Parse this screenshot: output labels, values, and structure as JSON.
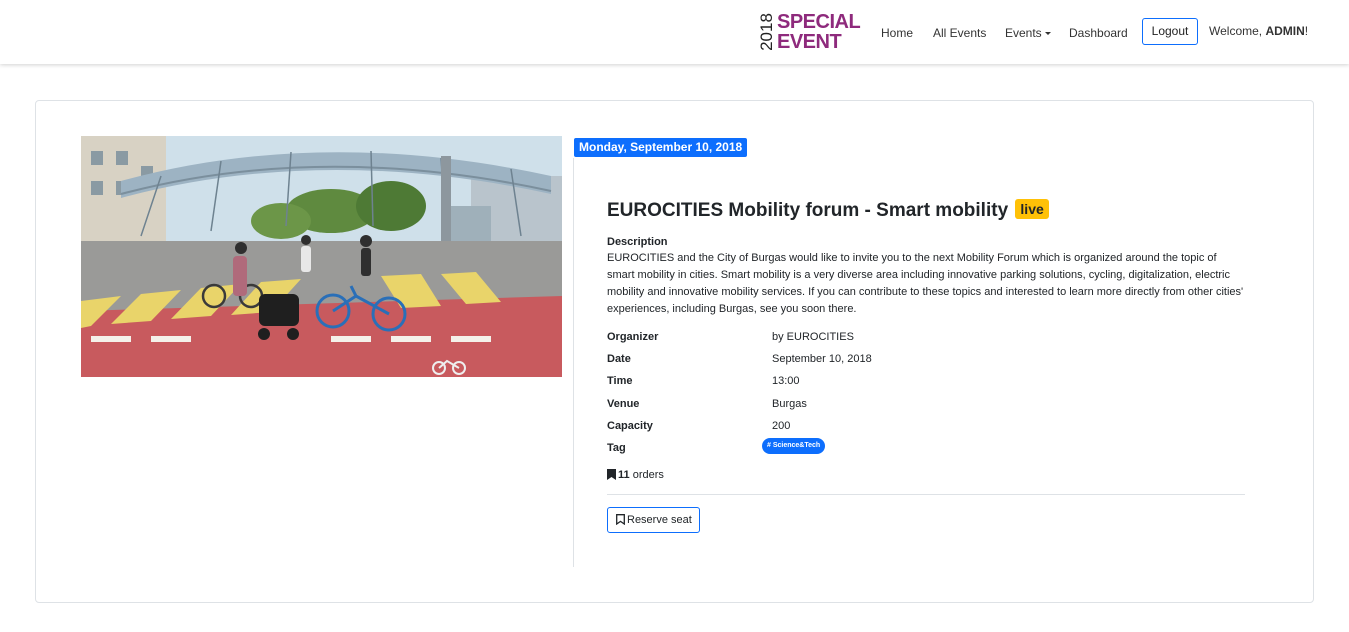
{
  "navbar": {
    "brand_year": "2018",
    "brand_line1": "SPECIAL",
    "brand_line2": "EVENT",
    "links": {
      "home": "Home",
      "all_events": "All Events",
      "events": "Events",
      "dashboard": "Dashboard"
    },
    "logout": "Logout",
    "welcome_prefix": "Welcome, ",
    "welcome_user": "ADMIN",
    "welcome_suffix": "!"
  },
  "event": {
    "date_badge": "Monday, September 10, 2018",
    "title": "EUROCITIES Mobility forum - Smart mobility",
    "status": "live",
    "description_label": "Description",
    "description": "EUROCITIES and the City of Burgas would like to invite you to the next Mobility Forum which is organized around the topic of smart mobility in cities. Smart mobility is a very diverse area including innovative parking solutions, cycling, digitalization, electric mobility and innovative mobility services. If you can contribute to these topics and interested to learn more directly from other cities' experiences, including Burgas, see you soon there.",
    "details": {
      "organizer_label": "Organizer",
      "organizer": "by EUROCITIES",
      "date_label": "Date",
      "date": "September 10, 2018",
      "time_label": "Time",
      "time": "13:00",
      "venue_label": "Venue",
      "venue": "Burgas",
      "capacity_label": "Capacity",
      "capacity": "200",
      "tag_label": "Tag",
      "tag": "# Science&Tech"
    },
    "orders_count": "11",
    "orders_suffix": " orders",
    "reserve_label": "Reserve seat"
  },
  "colors": {
    "primary": "#0d6efd",
    "brand": "#8e2a7c",
    "live": "#ffc107"
  },
  "icons": {
    "orders": "bookmark-fill-icon",
    "reserve": "bookmark-icon"
  }
}
